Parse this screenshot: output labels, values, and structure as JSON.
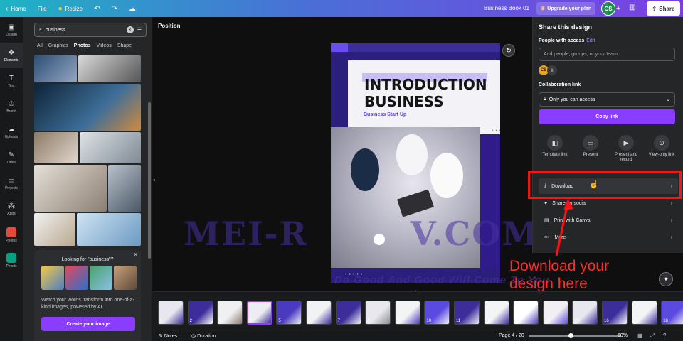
{
  "topbar": {
    "home": "Home",
    "file": "File",
    "resize": "Resize",
    "doc_title": "Business Book 01",
    "upgrade": "Upgrade your plan",
    "avatar": "CS",
    "share": "Share"
  },
  "rail": {
    "items": [
      "Design",
      "Elements",
      "Text",
      "Brand",
      "Uploads",
      "Draw",
      "Projects",
      "Apps",
      "Photos",
      "Pexels"
    ]
  },
  "panel": {
    "search_value": "business",
    "tabs": [
      "All",
      "Graphics",
      "Photos",
      "Videos",
      "Shape"
    ],
    "promo": {
      "title": "Looking for \"business\"?",
      "text": "Watch your words transform into one-of-a-kind images, powered by AI.",
      "button": "Create your image"
    }
  },
  "canvas": {
    "position_label": "Position",
    "doc": {
      "title_line1": "INTRODUCTION",
      "title_line2": "BUSINESS",
      "subtitle": "Business Start Up"
    }
  },
  "watermark": {
    "main": "MEI-R        V.COM",
    "sub": "Do Good And Good Will Come To You"
  },
  "share_panel": {
    "title": "Share this design",
    "people_label": "People with access",
    "edit": "Edit",
    "input_placeholder": "Add people, groups, or your team",
    "avatar": "CS",
    "collab_label": "Collaboration link",
    "access_value": "Only you can access",
    "copy_link": "Copy link",
    "actions": [
      {
        "label": "Template link",
        "icon": "template-icon"
      },
      {
        "label": "Present",
        "icon": "present-icon"
      },
      {
        "label": "Present and record",
        "icon": "record-icon"
      },
      {
        "label": "View-only link",
        "icon": "link-icon"
      }
    ],
    "rows": [
      "Download",
      "Share on social",
      "Print with Canva",
      "More"
    ]
  },
  "annotation": {
    "text": "Download your design here",
    "color": "#ff2a2a"
  },
  "strip": {
    "pages": [
      "1",
      "2",
      "3",
      "4",
      "5",
      "6",
      "7",
      "8",
      "9",
      "10",
      "11",
      "12",
      "13",
      "14",
      "15",
      "16",
      "17",
      "18"
    ],
    "current": 4
  },
  "bottombar": {
    "notes": "Notes",
    "duration": "Duration",
    "page": "Page 4 / 20",
    "zoom": "60%"
  },
  "colors": {
    "accent": "#8b3dff",
    "highlight": "#ff1212"
  }
}
